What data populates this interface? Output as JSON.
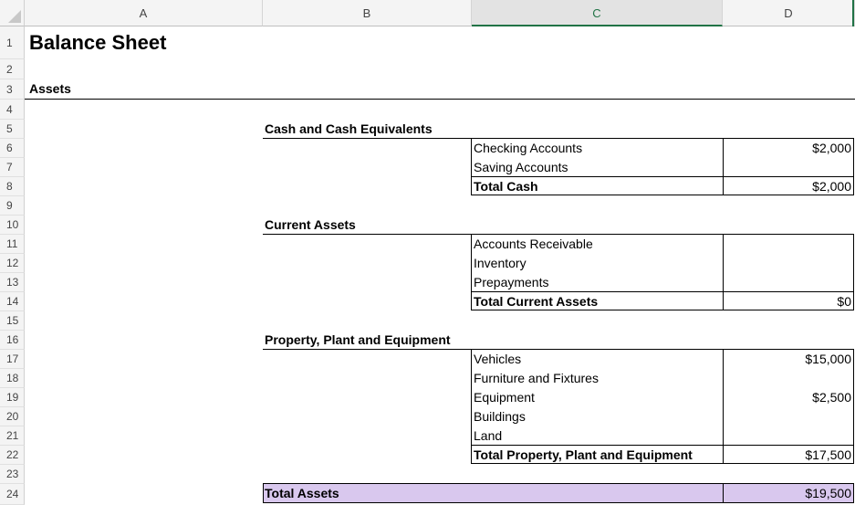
{
  "columns": [
    "A",
    "B",
    "C",
    "D"
  ],
  "rows": [
    "1",
    "2",
    "3",
    "4",
    "5",
    "6",
    "7",
    "8",
    "9",
    "10",
    "11",
    "12",
    "13",
    "14",
    "15",
    "16",
    "17",
    "18",
    "19",
    "20",
    "21",
    "22",
    "23",
    "24"
  ],
  "title": "Balance Sheet",
  "assets_heading": "Assets",
  "cash": {
    "heading": "Cash and Cash Equivalents",
    "items": [
      {
        "label": "Checking Accounts",
        "value": "$2,000"
      },
      {
        "label": "Saving Accounts",
        "value": ""
      }
    ],
    "total_label": "Total Cash",
    "total_value": "$2,000"
  },
  "current": {
    "heading": "Current Assets",
    "items": [
      {
        "label": "Accounts Receivable",
        "value": ""
      },
      {
        "label": "Inventory",
        "value": ""
      },
      {
        "label": "Prepayments",
        "value": ""
      }
    ],
    "total_label": "Total Current Assets",
    "total_value": "$0"
  },
  "ppe": {
    "heading": "Property, Plant and Equipment",
    "items": [
      {
        "label": "Vehicles",
        "value": "$15,000"
      },
      {
        "label": "Furniture and Fixtures",
        "value": ""
      },
      {
        "label": "Equipment",
        "value": "$2,500"
      },
      {
        "label": "Buildings",
        "value": ""
      },
      {
        "label": "Land",
        "value": ""
      }
    ],
    "total_label": "Total Property, Plant and Equipment",
    "total_value": "$17,500"
  },
  "total_assets": {
    "label": "Total Assets",
    "value": "$19,500"
  },
  "colors": {
    "accent": "#217346",
    "total_fill": "#d9c8ee"
  }
}
